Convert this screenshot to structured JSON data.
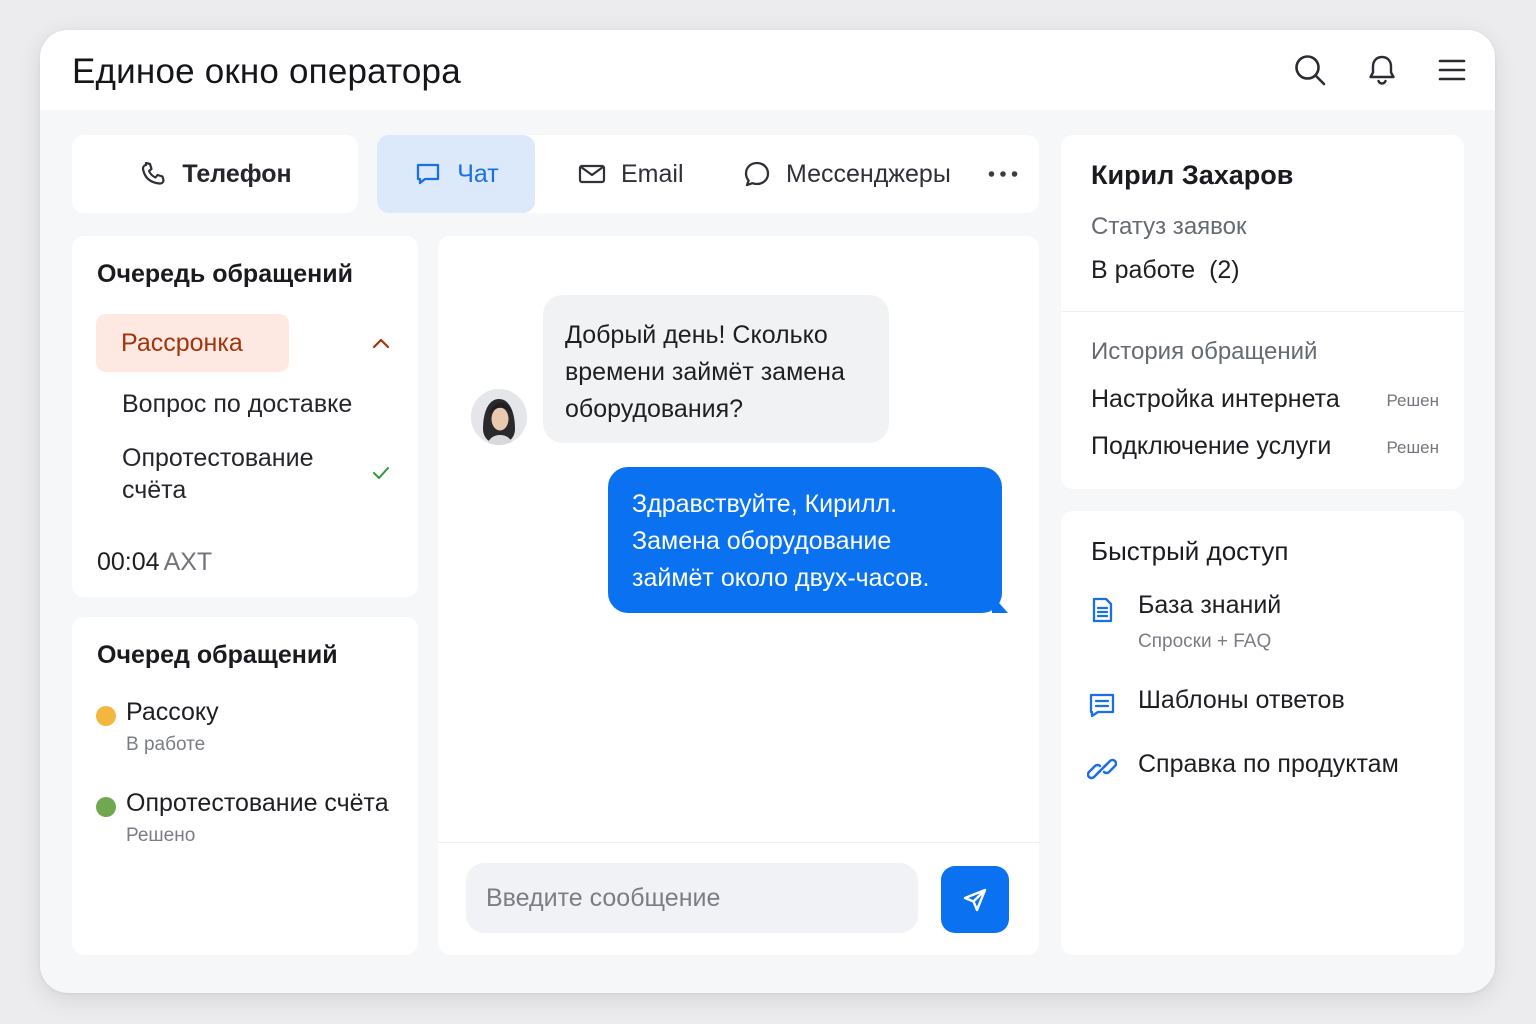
{
  "header": {
    "title": "Единое окно оператора",
    "icons": [
      "search-icon",
      "bell-icon",
      "menu-icon"
    ]
  },
  "channels": {
    "phone": "Телефон",
    "chat": "Чат",
    "email": "Email",
    "messengers": "Мессенджеры",
    "more": "···"
  },
  "queue": {
    "title": "Очередь обращений",
    "selected": "Рассронка",
    "item2": "Вопрос по доставке",
    "item3": "Опротестование счёта",
    "timer": "00:04",
    "timezone": "AXT"
  },
  "queue2": {
    "title": "Очеред обращений",
    "items": [
      {
        "name": "Рассоку",
        "status": "В работе",
        "color": "#f3b63f"
      },
      {
        "name": "Опротестование счёта",
        "status": "Решено",
        "color": "#6fa84f"
      }
    ]
  },
  "chat": {
    "incoming": "Добрый день! Сколько времени займёт замена оборудования?",
    "outgoing": "Здравствуйте, Кирилл. Замена оборудование займёт около двух-часов.",
    "input_placeholder": "Введите сообщение"
  },
  "client": {
    "name": "Кирил Захаров",
    "status_label": "Статуз заявок",
    "status_value": "В работе  (2)",
    "history_title": "История обращений",
    "history": [
      {
        "label": "Настройка интернета",
        "badge": "Решен"
      },
      {
        "label": "Подключение услуги",
        "badge": "Решен"
      }
    ]
  },
  "quick_access": {
    "title": "Быстрый доступ",
    "items": [
      {
        "label": "База знаний",
        "sub": "Спроски + FAQ",
        "icon": "document-icon"
      },
      {
        "label": "Шаблоны ответов",
        "icon": "message-lines-icon"
      },
      {
        "label": "Справка по продуктам",
        "icon": "link-icon"
      }
    ]
  },
  "colors": {
    "accent": "#0a72f0",
    "selected_bg": "#fde9e1",
    "selected_text": "#a1350f"
  }
}
